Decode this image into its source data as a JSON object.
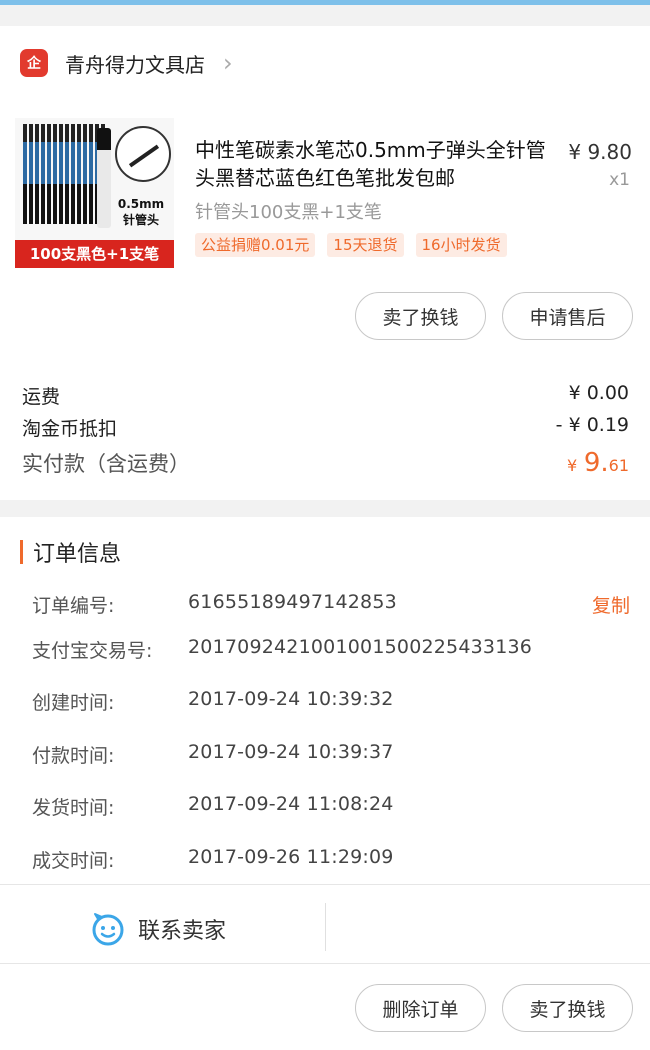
{
  "shop": {
    "name": "青舟得力文具店",
    "badge": "企"
  },
  "product": {
    "title": "中性笔碳素水笔芯0.5mm子弹头全针管头黑替芯蓝色红色笔批发包邮",
    "price": "¥ 9.80",
    "quantity": "x1",
    "sku": "针管头100支黑+1支笔",
    "tags": [
      "公益捐赠0.01元",
      "15天退货",
      "16小时发货"
    ],
    "image_text": {
      "spec": "0.5mm",
      "tip": "针管头",
      "band": "100支黑色+1支笔"
    }
  },
  "actions": {
    "sell": "卖了换钱",
    "after_sales": "申请售后"
  },
  "fees": {
    "freight_label": "运费",
    "freight_value": "¥ 0.00",
    "coin_label": "淘金币抵扣",
    "coin_value": "- ¥ 0.19",
    "paid_label": "实付款（含运费）",
    "paid_symbol": "¥",
    "paid_int": "9.",
    "paid_dec": "61"
  },
  "order_info": {
    "title": "订单信息",
    "copy": "复制",
    "rows": [
      {
        "label": "订单编号:",
        "value": "61655189497142853"
      },
      {
        "label": "支付宝交易号:",
        "value": "2017092421001001500225433136"
      },
      {
        "label": "创建时间:",
        "value": "2017-09-24 10:39:32"
      },
      {
        "label": "付款时间:",
        "value": "2017-09-24 10:39:37"
      },
      {
        "label": "发货时间:",
        "value": "2017-09-24 11:08:24"
      },
      {
        "label": "成交时间:",
        "value": "2017-09-26 11:29:09"
      }
    ]
  },
  "contact": {
    "label": "联系卖家"
  },
  "bottom_actions": {
    "delete": "删除订单",
    "sell": "卖了换钱"
  },
  "colors": {
    "accent": "#ef6a2c",
    "shop_badge": "#e23a2e",
    "top_bar": "#7ec0ea",
    "contact_icon": "#3ba6e8"
  }
}
